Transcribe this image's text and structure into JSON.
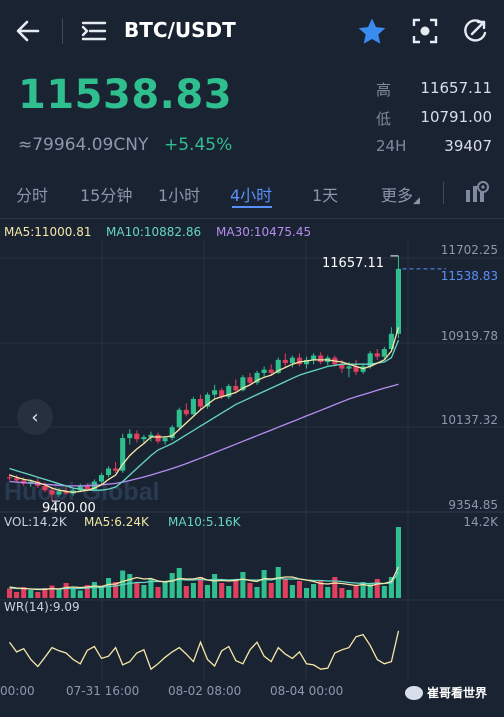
{
  "header": {
    "pair": "BTC/USDT"
  },
  "ticker": {
    "last": "11538.83",
    "cny": "≈79964.09CNY",
    "change": "+5.45%"
  },
  "stats": [
    {
      "label": "高",
      "value": "11657.11"
    },
    {
      "label": "低",
      "value": "10791.00"
    },
    {
      "label": "24H",
      "value": "39407"
    }
  ],
  "tabs": [
    {
      "label": "分时"
    },
    {
      "label": "15分钟"
    },
    {
      "label": "1小时"
    },
    {
      "label": "4小时",
      "active": true
    },
    {
      "label": "1天"
    },
    {
      "label": "更多"
    }
  ],
  "indicators": {
    "ma5": "MA5:11000.81",
    "ma10": "MA10:10882.86",
    "ma30": "MA30:10475.45",
    "vol": "VOL:14.2K",
    "vol_ma5": "MA5:6.24K",
    "vol_ma10": "MA10:5.16K",
    "wr": "WR(14):9.09"
  },
  "price_axis": [
    "11702.25",
    "11538.83",
    "10919.78",
    "10137.32",
    "9354.85"
  ],
  "vol_axis": "14.2K",
  "annotations": {
    "high": "11657.11",
    "low": "9400.00"
  },
  "time_axis": [
    "00:00",
    "07-31 16:00",
    "08-02 08:00",
    "08-04 00:00"
  ],
  "watermark": "Huobi Global",
  "credit": "崔哥看世界",
  "colors": {
    "up": "#2fbf8f",
    "down": "#e0405e",
    "accent": "#5b8ff9",
    "ma5": "#f5e7a6",
    "ma10": "#65d6c4",
    "ma30": "#b78df0"
  },
  "chart_data": {
    "type": "candlestick",
    "title": "BTC/USDT 4小时",
    "ohlc": [
      [
        9620,
        9650,
        9590,
        9610
      ],
      [
        9610,
        9640,
        9570,
        9590
      ],
      [
        9590,
        9620,
        9540,
        9560
      ],
      [
        9560,
        9600,
        9530,
        9580
      ],
      [
        9580,
        9610,
        9520,
        9540
      ],
      [
        9540,
        9570,
        9480,
        9500
      ],
      [
        9500,
        9530,
        9400,
        9460
      ],
      [
        9460,
        9520,
        9440,
        9490
      ],
      [
        9490,
        9530,
        9460,
        9470
      ],
      [
        9470,
        9520,
        9450,
        9500
      ],
      [
        9500,
        9560,
        9480,
        9540
      ],
      [
        9540,
        9560,
        9490,
        9510
      ],
      [
        9510,
        9600,
        9500,
        9580
      ],
      [
        9580,
        9660,
        9560,
        9640
      ],
      [
        9640,
        9720,
        9620,
        9700
      ],
      [
        9700,
        9760,
        9660,
        9680
      ],
      [
        9680,
        10020,
        9660,
        9980
      ],
      [
        9980,
        10060,
        9920,
        10020
      ],
      [
        10020,
        10050,
        9940,
        9970
      ],
      [
        9970,
        10010,
        9930,
        9990
      ],
      [
        9990,
        10040,
        9950,
        10010
      ],
      [
        10010,
        10030,
        9930,
        9950
      ],
      [
        9950,
        10000,
        9920,
        9980
      ],
      [
        9980,
        10100,
        9960,
        10080
      ],
      [
        10080,
        10260,
        10060,
        10240
      ],
      [
        10240,
        10300,
        10180,
        10200
      ],
      [
        10200,
        10360,
        10190,
        10340
      ],
      [
        10340,
        10380,
        10240,
        10270
      ],
      [
        10270,
        10400,
        10250,
        10380
      ],
      [
        10380,
        10470,
        10350,
        10420
      ],
      [
        10420,
        10440,
        10340,
        10360
      ],
      [
        10360,
        10480,
        10340,
        10460
      ],
      [
        10460,
        10520,
        10400,
        10420
      ],
      [
        10420,
        10560,
        10410,
        10540
      ],
      [
        10540,
        10580,
        10470,
        10490
      ],
      [
        10490,
        10600,
        10470,
        10580
      ],
      [
        10580,
        10640,
        10540,
        10610
      ],
      [
        10610,
        10660,
        10560,
        10580
      ],
      [
        10580,
        10720,
        10570,
        10700
      ],
      [
        10700,
        10760,
        10640,
        10670
      ],
      [
        10670,
        10740,
        10630,
        10720
      ],
      [
        10720,
        10760,
        10640,
        10660
      ],
      [
        10660,
        10730,
        10620,
        10700
      ],
      [
        10700,
        10760,
        10660,
        10740
      ],
      [
        10740,
        10770,
        10660,
        10680
      ],
      [
        10680,
        10740,
        10650,
        10720
      ],
      [
        10720,
        10740,
        10640,
        10660
      ],
      [
        10660,
        10700,
        10580,
        10620
      ],
      [
        10620,
        10680,
        10540,
        10640
      ],
      [
        10640,
        10700,
        10560,
        10590
      ],
      [
        10590,
        10660,
        10570,
        10640
      ],
      [
        10640,
        10780,
        10620,
        10760
      ],
      [
        10760,
        10800,
        10700,
        10730
      ],
      [
        10730,
        10820,
        10710,
        10800
      ],
      [
        10800,
        11000,
        10791,
        10940
      ],
      [
        10940,
        11657,
        10900,
        11538
      ]
    ],
    "ma5": [
      9640,
      9620,
      9600,
      9590,
      9570,
      9550,
      9520,
      9500,
      9490,
      9480,
      9490,
      9500,
      9520,
      9550,
      9600,
      9640,
      9740,
      9820,
      9880,
      9930,
      9990,
      9990,
      9990,
      10000,
      10060,
      10120,
      10180,
      10240,
      10290,
      10340,
      10360,
      10380,
      10400,
      10440,
      10470,
      10510,
      10540,
      10560,
      10600,
      10630,
      10660,
      10680,
      10690,
      10700,
      10700,
      10700,
      10690,
      10680,
      10660,
      10640,
      10620,
      10640,
      10670,
      10700,
      10780,
      11000
    ],
    "ma10": [
      9700,
      9680,
      9660,
      9640,
      9620,
      9600,
      9580,
      9560,
      9540,
      9520,
      9510,
      9500,
      9500,
      9500,
      9510,
      9530,
      9580,
      9640,
      9700,
      9760,
      9820,
      9870,
      9900,
      9930,
      9970,
      10010,
      10050,
      10090,
      10130,
      10170,
      10210,
      10250,
      10290,
      10320,
      10350,
      10380,
      10410,
      10440,
      10470,
      10500,
      10530,
      10560,
      10580,
      10600,
      10620,
      10640,
      10650,
      10660,
      10660,
      10660,
      10660,
      10660,
      10670,
      10680,
      10720,
      10880
    ],
    "ma30": [
      9580,
      9575,
      9570,
      9565,
      9560,
      9555,
      9550,
      9545,
      9540,
      9540,
      9540,
      9542,
      9545,
      9550,
      9556,
      9563,
      9575,
      9590,
      9606,
      9622,
      9640,
      9660,
      9680,
      9700,
      9722,
      9745,
      9770,
      9795,
      9820,
      9846,
      9872,
      9898,
      9924,
      9950,
      9976,
      10002,
      10028,
      10054,
      10080,
      10106,
      10132,
      10158,
      10184,
      10210,
      10236,
      10262,
      10288,
      10314,
      10340,
      10360,
      10380,
      10400,
      10420,
      10440,
      10458,
      10475
    ],
    "volume": [
      1.9,
      1.2,
      2.2,
      1.6,
      1.2,
      2.0,
      2.5,
      1.7,
      3.0,
      2.0,
      1.5,
      2.6,
      3.2,
      2.4,
      4.0,
      3.2,
      5.5,
      4.8,
      3.0,
      2.6,
      3.8,
      2.2,
      3.4,
      5.0,
      6.0,
      2.4,
      3.0,
      4.2,
      2.6,
      4.8,
      3.0,
      2.4,
      3.8,
      5.2,
      3.0,
      2.2,
      5.6,
      3.0,
      6.2,
      3.8,
      2.6,
      3.4,
      2.0,
      2.8,
      3.6,
      2.2,
      4.2,
      2.0,
      1.6,
      2.4,
      3.2,
      2.8,
      3.8,
      2.4,
      4.2,
      14.2
    ],
    "vol_ma5": [
      2.2,
      2.0,
      1.9,
      1.8,
      1.7,
      1.7,
      1.9,
      1.8,
      2.1,
      2.2,
      2.1,
      2.2,
      2.4,
      2.3,
      2.7,
      2.8,
      3.3,
      3.7,
      4.1,
      3.8,
      3.9,
      3.4,
      3.2,
      3.4,
      3.9,
      3.8,
      3.8,
      4.1,
      3.6,
      3.4,
      3.5,
      3.4,
      3.5,
      3.8,
      3.5,
      3.3,
      3.9,
      3.8,
      4.0,
      4.2,
      4.2,
      3.8,
      3.6,
      3.3,
      2.9,
      2.8,
      3.0,
      2.9,
      2.7,
      2.5,
      2.7,
      2.4,
      2.8,
      2.9,
      3.3,
      6.2
    ],
    "vol_ma10": [
      2.0,
      1.9,
      1.9,
      1.8,
      1.8,
      1.8,
      1.8,
      1.8,
      1.9,
      1.9,
      1.9,
      2.0,
      2.1,
      2.1,
      2.3,
      2.4,
      2.7,
      2.9,
      3.1,
      3.1,
      3.3,
      3.3,
      3.3,
      3.5,
      3.7,
      3.6,
      3.6,
      3.7,
      3.6,
      3.7,
      3.7,
      3.6,
      3.7,
      3.7,
      3.6,
      3.6,
      3.7,
      3.6,
      3.9,
      3.8,
      3.8,
      3.8,
      3.6,
      3.5,
      3.5,
      3.4,
      3.4,
      3.3,
      3.1,
      3.0,
      2.9,
      2.9,
      3.0,
      2.9,
      3.0,
      5.2
    ],
    "wr": [
      -30,
      -48,
      -42,
      -62,
      -75,
      -58,
      -40,
      -46,
      -50,
      -62,
      -70,
      -45,
      -38,
      -60,
      -56,
      -40,
      -72,
      -66,
      -50,
      -44,
      -80,
      -70,
      -58,
      -48,
      -40,
      -52,
      -66,
      -30,
      -62,
      -74,
      -46,
      -38,
      -64,
      -70,
      -44,
      -30,
      -56,
      -66,
      -40,
      -52,
      -60,
      -48,
      -70,
      -72,
      -80,
      -78,
      -50,
      -44,
      -40,
      -20,
      -16,
      -36,
      -62,
      -70,
      -66,
      -9.09
    ],
    "x_labels": [
      "00:00",
      "07-31 16:00",
      "08-02 08:00",
      "08-04 00:00"
    ],
    "y_range": [
      9354.85,
      11702.25
    ],
    "grid": true
  }
}
